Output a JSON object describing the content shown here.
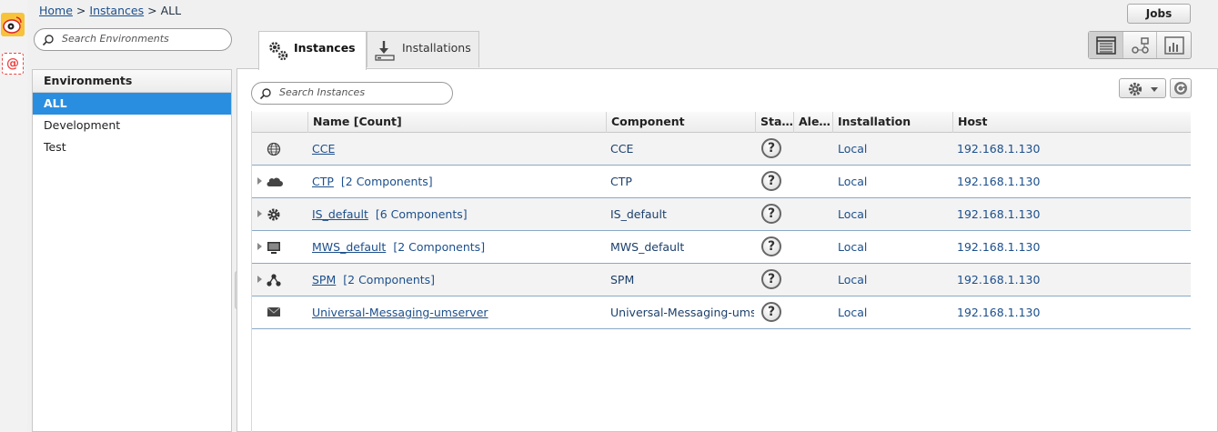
{
  "breadcrumb": {
    "home": "Home",
    "sep1": ">",
    "instances": "Instances",
    "sep2": ">",
    "current": "ALL"
  },
  "env_search": {
    "placeholder": "Search Environments"
  },
  "environments": {
    "header": "Environments",
    "items": [
      {
        "label": "ALL",
        "selected": true
      },
      {
        "label": "Development",
        "selected": false
      },
      {
        "label": "Test",
        "selected": false
      }
    ]
  },
  "tabs": [
    {
      "label": "Instances",
      "icon": "gears-icon",
      "active": true
    },
    {
      "label": "Installations",
      "icon": "download-icon",
      "active": false
    }
  ],
  "jobs_button": "Jobs",
  "view_toggle": [
    "list-view-icon",
    "topology-view-icon",
    "chart-view-icon"
  ],
  "instance_search": {
    "placeholder": "Search Instances"
  },
  "grid": {
    "headers": {
      "name": "Name [Count]",
      "component": "Component",
      "status": "Sta…",
      "alerts": "Ale…",
      "installation": "Installation",
      "host": "Host"
    },
    "rows": [
      {
        "icon": "globe-icon",
        "expandable": false,
        "name": "CCE",
        "count": "",
        "component": "CCE",
        "status": "?",
        "installation": "Local",
        "host": "192.168.1.130"
      },
      {
        "icon": "cloud-icon",
        "expandable": true,
        "name": "CTP",
        "count": "[2 Components]",
        "component": "CTP",
        "status": "?",
        "installation": "Local",
        "host": "192.168.1.130"
      },
      {
        "icon": "gear-icon",
        "expandable": true,
        "name": "IS_default",
        "count": "[6 Components]",
        "component": "IS_default",
        "status": "?",
        "installation": "Local",
        "host": "192.168.1.130"
      },
      {
        "icon": "monitor-icon",
        "expandable": true,
        "name": "MWS_default",
        "count": "[2 Components]",
        "component": "MWS_default",
        "status": "?",
        "installation": "Local",
        "host": "192.168.1.130"
      },
      {
        "icon": "network-icon",
        "expandable": true,
        "name": "SPM",
        "count": "[2 Components]",
        "component": "SPM",
        "status": "?",
        "installation": "Local",
        "host": "192.168.1.130"
      },
      {
        "icon": "envelope-icon",
        "expandable": false,
        "name": "Universal-Messaging-umserver",
        "count": "",
        "component": "Universal-Messaging-umser",
        "status": "?",
        "installation": "Local",
        "host": "192.168.1.130"
      }
    ]
  }
}
